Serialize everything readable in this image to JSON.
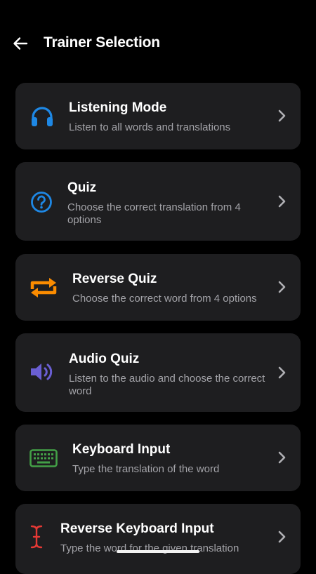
{
  "header": {
    "title": "Trainer Selection",
    "back_icon": "arrow-left-icon"
  },
  "trainers": [
    {
      "title": "Listening Mode",
      "description": "Listen to all words and translations",
      "icon": "headphones-icon",
      "icon_color": "#1e88e5"
    },
    {
      "title": "Quiz",
      "description": "Choose the correct translation from 4 options",
      "icon": "question-circle-icon",
      "icon_color": "#1e88e5"
    },
    {
      "title": "Reverse Quiz",
      "description": "Choose the correct word from 4 options",
      "icon": "repeat-arrows-icon",
      "icon_color": "#fb8c00"
    },
    {
      "title": "Audio Quiz",
      "description": "Listen to the audio and choose the correct word",
      "icon": "speaker-icon",
      "icon_color": "#6a5fd3"
    },
    {
      "title": "Keyboard Input",
      "description": "Type the translation of the word",
      "icon": "keyboard-icon",
      "icon_color": "#43a047"
    },
    {
      "title": "Reverse Keyboard Input",
      "description": "Type the word for the given translation",
      "icon": "text-cursor-icon",
      "icon_color": "#e53935"
    }
  ],
  "colors": {
    "background": "#000000",
    "card": "#1e1e20",
    "secondary_text": "#a3a3a8",
    "chevron": "#b0b0b4"
  }
}
